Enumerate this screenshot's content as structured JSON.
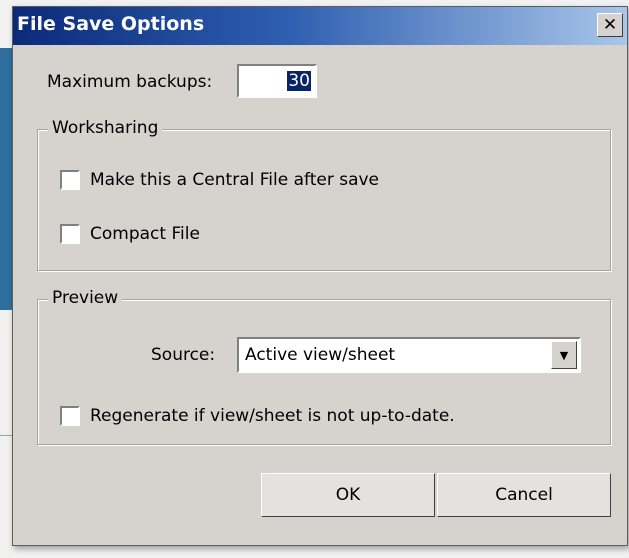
{
  "dialog": {
    "title": "File Save Options",
    "close_glyph": "✕",
    "max_backups_label": "Maximum backups:",
    "max_backups_value": "30",
    "worksharing": {
      "legend": "Worksharing",
      "central_file_label": "Make this a Central File after save",
      "central_file_checked": false,
      "compact_label": "Compact File",
      "compact_checked": false
    },
    "preview": {
      "legend": "Preview",
      "source_label": "Source:",
      "source_value": "Active view/sheet",
      "dropdown_arrow": "▼",
      "regenerate_label": "Regenerate if view/sheet is not up-to-date.",
      "regenerate_checked": false
    },
    "ok_label": "OK",
    "cancel_label": "Cancel"
  },
  "colors": {
    "title_bar_start": "#0b2a7a",
    "dialog_face": "#d6d3ce",
    "selection": "#0a246a"
  }
}
